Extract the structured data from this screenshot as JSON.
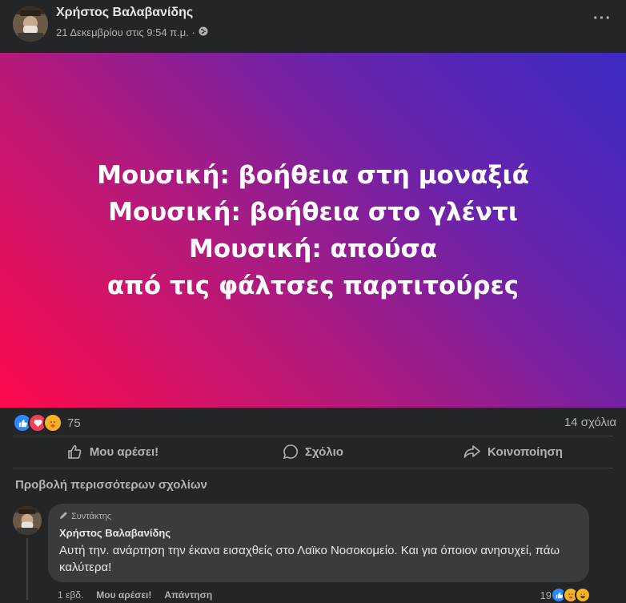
{
  "post": {
    "author": "Χρήστος Βαλαβανίδης",
    "timestamp": "21 Δεκεμβρίου στις 9:54 π.μ. ·",
    "privacy_icon": "globe-icon",
    "more_label": "···",
    "banner": {
      "lines": [
        "Μουσική: βοήθεια στη μοναξιά",
        "Μουσική: βοήθεια στο γλέντι",
        "Μουσική: απούσα",
        "από τις φάλτσες παρτιτούρες"
      ],
      "gradient_colors": [
        "#ff0a4c",
        "#3b2bc4"
      ]
    },
    "reactions": {
      "types": [
        "like-icon",
        "love-icon",
        "care-icon"
      ],
      "count": "75"
    },
    "comments_count": "14 σχόλια"
  },
  "actions": {
    "like_label": "Μου αρέσει!",
    "comment_label": "Σχόλιο",
    "share_label": "Κοινοποίηση"
  },
  "comments_section": {
    "view_more": "Προβολή περισσότερων σχολίων",
    "comment": {
      "badge": "Συντάκτης",
      "author": "Χρήστος Βαλαβανίδης",
      "text": "Αυτή την. ανάρτηση την έκανα εισαχθείς στο Λαϊκο Νοσοκομείο. Και για όποιον ανησυχεί, πάω καλύτερα!",
      "reaction_count": "19",
      "time": "1 εβδ.",
      "like_link": "Μου αρέσει!",
      "reply_link": "Απάντηση"
    }
  },
  "colors": {
    "background": "#242526",
    "bubble": "#3a3b3c",
    "primary_text": "#e4e6eb",
    "secondary_text": "#b0b3b8",
    "like_blue": "#2d88ff"
  }
}
